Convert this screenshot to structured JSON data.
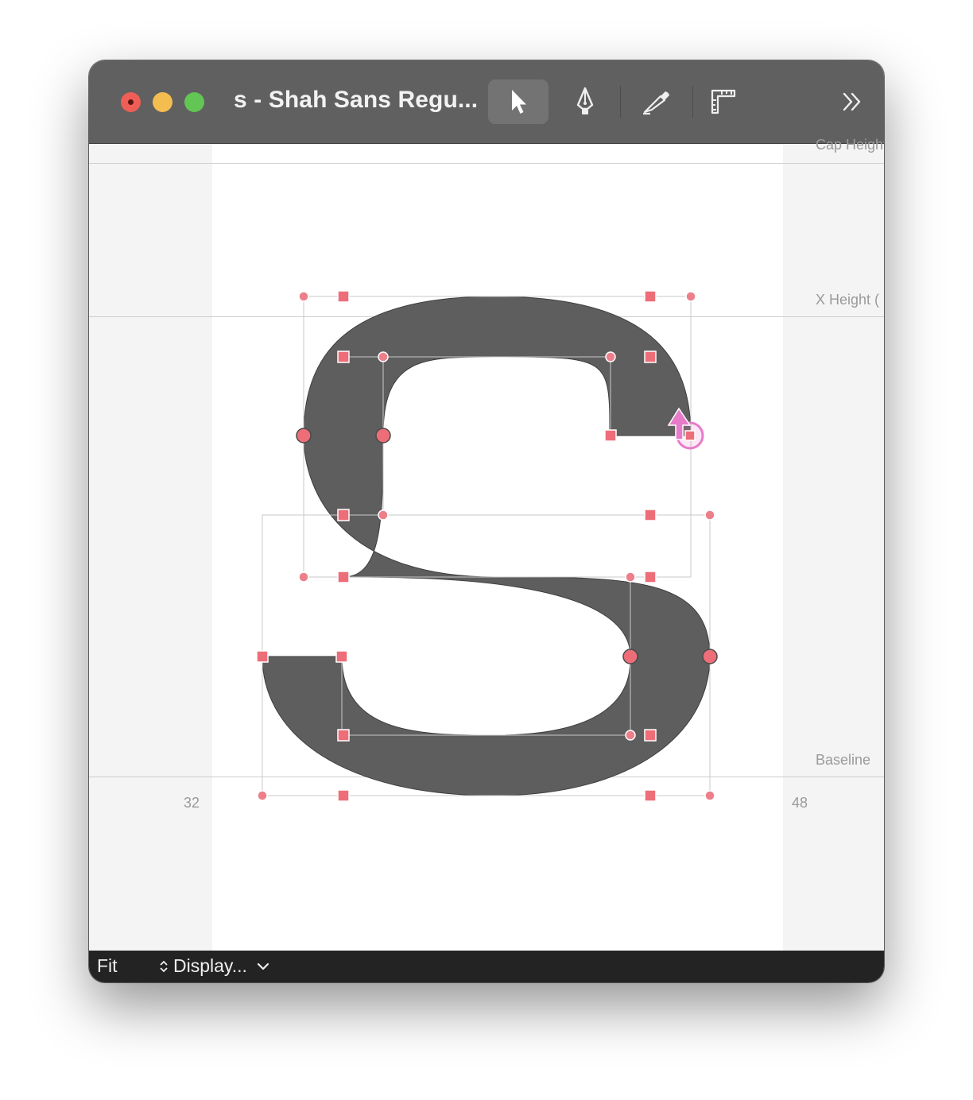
{
  "window": {
    "title": "s - Shah Sans Regu...",
    "tools": [
      {
        "id": "select",
        "icon": "pointer-arrow-icon",
        "active": true
      },
      {
        "id": "pen",
        "icon": "pen-nib-icon",
        "active": false
      },
      {
        "id": "knife",
        "icon": "knife-icon",
        "active": false
      },
      {
        "id": "measure",
        "icon": "ruler-icon",
        "active": false
      }
    ],
    "overflow_icon": "double-chevron-right-icon"
  },
  "metrics": {
    "cap_height": "Cap Height",
    "x_height": "X Height (",
    "baseline": "Baseline"
  },
  "rulers": {
    "left": "32",
    "right": "48"
  },
  "statusbar": {
    "zoom": "Fit",
    "display": "Display..."
  },
  "colors": {
    "glyph_fill": "#5e5e5e",
    "point": "#ed6e78",
    "selection": "#e77bc9",
    "titlebar": "#606060"
  }
}
